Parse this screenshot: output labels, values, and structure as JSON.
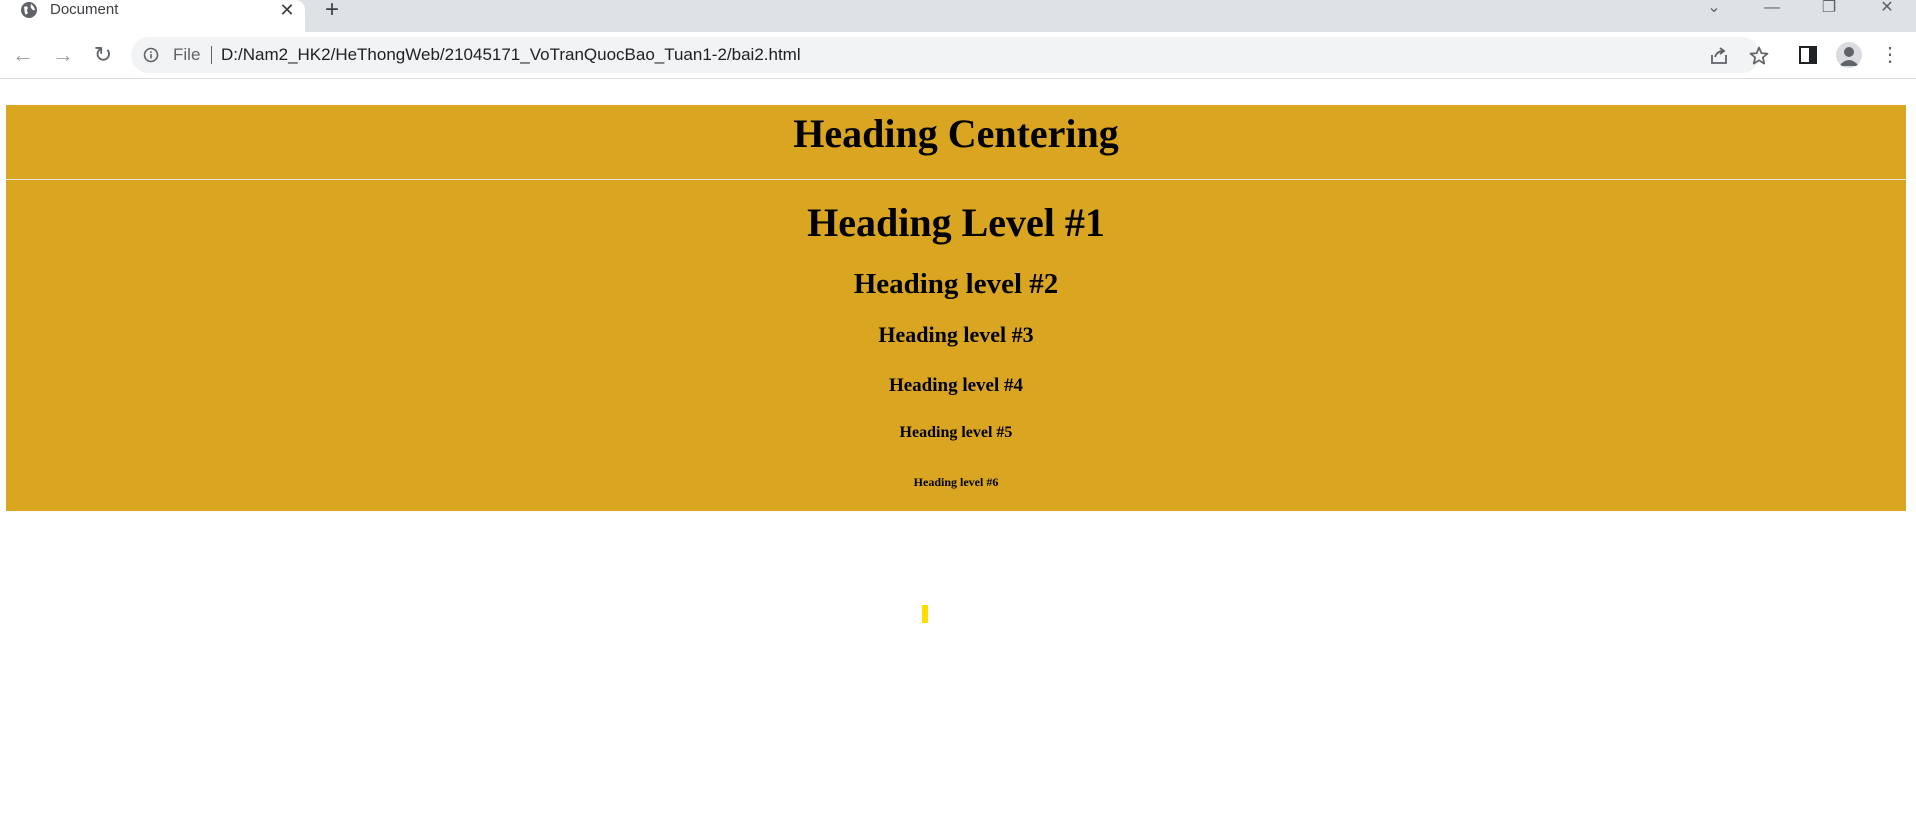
{
  "browser": {
    "tab_title": "Document",
    "tab_close": "✕",
    "new_tab": "+",
    "omnibox": {
      "scheme_label": "File",
      "url": "D:/Nam2_HK2/HeThongWeb/21045171_VoTranQuocBao_Tuan1-2/bai2.html"
    },
    "window_controls": {
      "tab_search": "⌄",
      "minimize": "—",
      "restore": "❐",
      "close": "✕"
    },
    "nav": {
      "back": "←",
      "forward": "→",
      "reload": "↻"
    },
    "menu": "⋮"
  },
  "page": {
    "heading_centering": "Heading Centering",
    "headings": {
      "h1": "Heading Level #1",
      "h2": "Heading level #2",
      "h3": "Heading level #3",
      "h4": "Heading level #4",
      "h5": "Heading level #5",
      "h6": "Heading level #6"
    }
  },
  "colors": {
    "page_block_background": "#daa520",
    "tabstrip": "#dee1e6",
    "omnibox": "#f1f3f4",
    "cursor_mark": "#ffdd00"
  }
}
